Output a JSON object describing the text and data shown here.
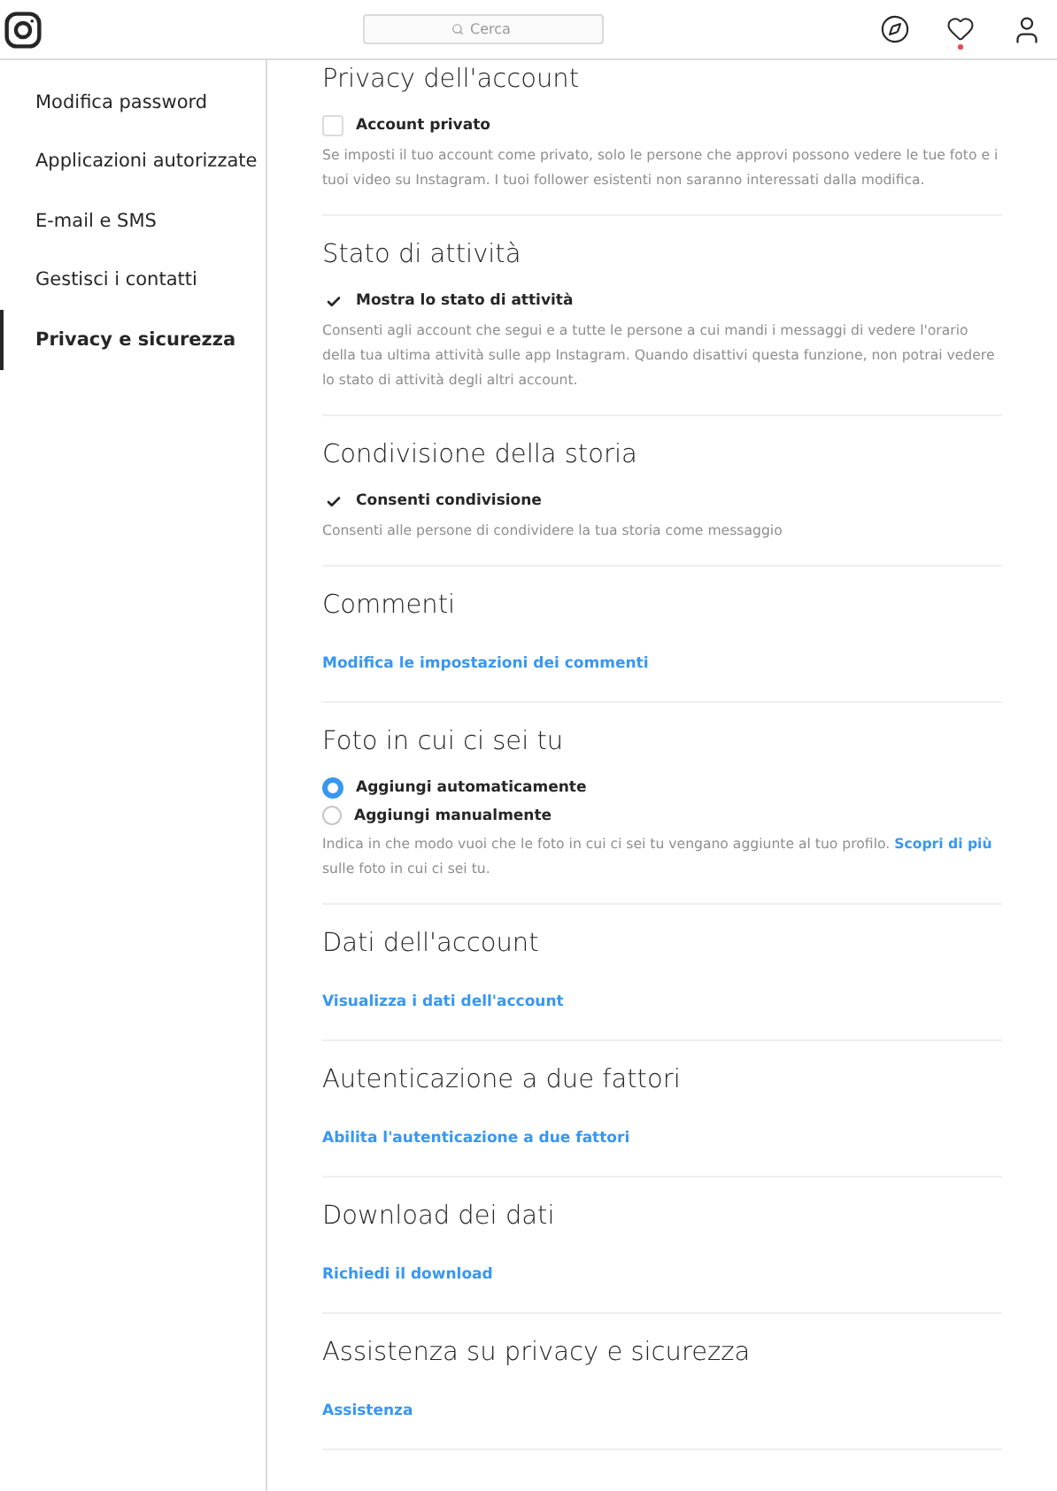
{
  "header": {
    "search": {
      "placeholder": "Cerca"
    },
    "activity_notification": true
  },
  "sidebar": {
    "items": [
      {
        "label": "Modifica password",
        "selected": false
      },
      {
        "label": "Applicazioni autorizzate",
        "selected": false
      },
      {
        "label": "E-mail e SMS",
        "selected": false
      },
      {
        "label": "Gestisci i contatti",
        "selected": false
      },
      {
        "label": "Privacy e sicurezza",
        "selected": true
      }
    ]
  },
  "sections": [
    {
      "title": "Privacy dell'account",
      "kind": "checkbox",
      "options": [
        {
          "label": "Account privato",
          "checked": false
        }
      ],
      "description": "Se imposti il tuo account come privato, solo le persone che approvi possono vedere le tue foto e i tuoi video su Instagram. I tuoi follower esistenti non saranno interessati dalla modifica."
    },
    {
      "title": "Stato di attività",
      "kind": "checkbox",
      "options": [
        {
          "label": "Mostra lo stato di attività",
          "checked": true
        }
      ],
      "description": "Consenti agli account che segui e a tutte le persone a cui mandi i messaggi di vedere l'orario della tua ultima attività sulle app Instagram. Quando disattivi questa funzione, non potrai vedere lo stato di attività degli altri account."
    },
    {
      "title": "Condivisione della storia",
      "kind": "checkbox",
      "options": [
        {
          "label": "Consenti condivisione",
          "checked": true
        }
      ],
      "description": "Consenti alle persone di condividere la tua storia come messaggio"
    },
    {
      "title": "Commenti",
      "kind": "link",
      "link": "Modifica le impostazioni dei commenti"
    },
    {
      "title": "Foto in cui ci sei tu",
      "kind": "radio",
      "options": [
        {
          "label": "Aggiungi automaticamente",
          "selected": true
        },
        {
          "label": "Aggiungi manualmente",
          "selected": false
        }
      ],
      "description": "Indica in che modo vuoi che le foto in cui ci sei tu vengano aggiunte al tuo profilo.",
      "description_link": "Scopri di più",
      "description_after": "sulle foto in cui ci sei tu."
    },
    {
      "title": "Dati dell'account",
      "kind": "link",
      "link": "Visualizza i dati dell'account"
    },
    {
      "title": "Autenticazione a due fattori",
      "kind": "link",
      "link": "Abilita l'autenticazione a due fattori"
    },
    {
      "title": "Download dei dati",
      "kind": "link",
      "link": "Richiedi il download"
    },
    {
      "title": "Assistenza su privacy e sicurezza",
      "kind": "link",
      "link": "Assistenza"
    }
  ]
}
